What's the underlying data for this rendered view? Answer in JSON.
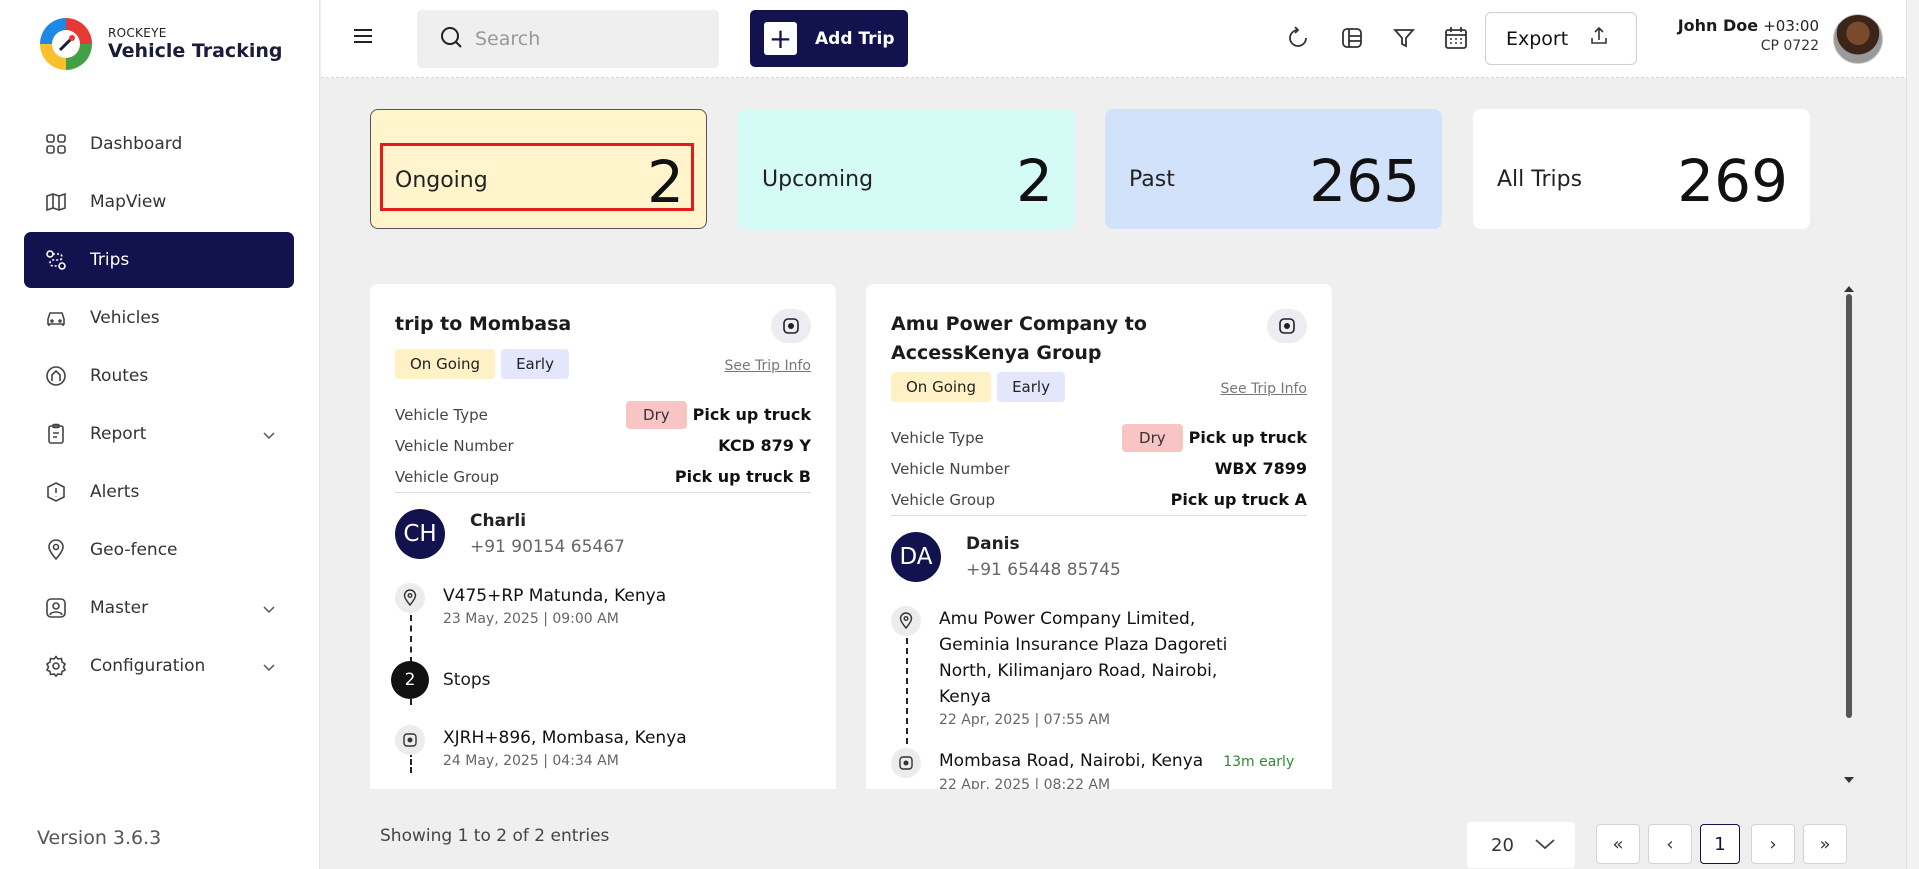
{
  "app": {
    "brand_small": "ROCKEYE",
    "brand_big": "Vehicle Tracking",
    "version": "Version 3.6.3"
  },
  "sidebar": {
    "items": [
      {
        "label": "Dashboard",
        "icon": "grid-icon"
      },
      {
        "label": "MapView",
        "icon": "map-icon"
      },
      {
        "label": "Trips",
        "icon": "route-icon",
        "active": true
      },
      {
        "label": "Vehicles",
        "icon": "car-icon"
      },
      {
        "label": "Routes",
        "icon": "routes-icon"
      },
      {
        "label": "Report",
        "icon": "clipboard-icon",
        "expandable": true
      },
      {
        "label": "Alerts",
        "icon": "alert-icon"
      },
      {
        "label": "Geo-fence",
        "icon": "pin-icon"
      },
      {
        "label": "Master",
        "icon": "user-square-icon",
        "expandable": true
      },
      {
        "label": "Configuration",
        "icon": "gear-icon",
        "expandable": true
      }
    ]
  },
  "topbar": {
    "search_placeholder": "Search",
    "add_trip_label": "Add Trip",
    "export_label": "Export",
    "user_name": "John Doe",
    "user_tz": "+03:00",
    "user_code": "CP 0722"
  },
  "stats": {
    "ongoing": {
      "label": "Ongoing",
      "value": "2"
    },
    "upcoming": {
      "label": "Upcoming",
      "value": "2"
    },
    "past": {
      "label": "Past",
      "value": "265"
    },
    "all": {
      "label": "All Trips",
      "value": "269"
    }
  },
  "trips": [
    {
      "title": "trip to Mombasa",
      "status": "On Going",
      "timing": "Early",
      "see_info": "See Trip Info",
      "vehicle_type_label": "Vehicle Type",
      "vehicle_type_tag": "Dry",
      "vehicle_type": "Pick up truck",
      "vehicle_number_label": "Vehicle Number",
      "vehicle_number": "KCD 879 Y",
      "vehicle_group_label": "Vehicle Group",
      "vehicle_group": "Pick up truck B",
      "driver_initials": "CH",
      "driver_name": "Charli",
      "driver_phone": "+91 90154 65467",
      "origin": "V475+RP Matunda, Kenya",
      "origin_date": "23 May, 2025 | 09:00 AM",
      "stops_count": "2",
      "stops_label": "Stops",
      "destination": "XJRH+896, Mombasa, Kenya",
      "destination_date": "24 May, 2025 | 04:34 AM"
    },
    {
      "title": "Amu Power Company to AccessKenya Group",
      "status": "On Going",
      "timing": "Early",
      "see_info": "See Trip Info",
      "vehicle_type_label": "Vehicle Type",
      "vehicle_type_tag": "Dry",
      "vehicle_type": "Pick up truck",
      "vehicle_number_label": "Vehicle Number",
      "vehicle_number": "WBX 7899",
      "vehicle_group_label": "Vehicle Group",
      "vehicle_group": "Pick up truck A",
      "driver_initials": "DA",
      "driver_name": "Danis",
      "driver_phone": "+91 65448 85745",
      "origin": "Amu Power Company Limited, Geminia Insurance Plaza Dagoreti North, Kilimanjaro Road, Nairobi, Kenya",
      "origin_date": "22 Apr, 2025 | 07:55 AM",
      "destination": "Mombasa Road, Nairobi, Kenya",
      "destination_early": "13m early",
      "destination_date": "22 Apr, 2025 | 08:22 AM"
    }
  ],
  "footer": {
    "showing": "Showing 1 to 2 of 2 entries",
    "page_size": "20",
    "current_page": "1"
  },
  "colors": {
    "primary": "#12124f",
    "ongoing_bg": "#fff4cc",
    "upcoming_bg": "#d4fbf5",
    "past_bg": "#d3e2fb",
    "highlight": "#e31b1b",
    "early_text": "#2e8b2e"
  }
}
